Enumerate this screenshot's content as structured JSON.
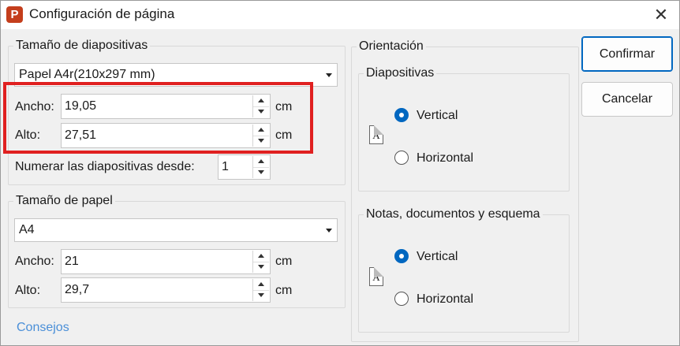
{
  "window": {
    "title": "Configuración de página",
    "app_icon_letter": "P",
    "close_glyph": "✕"
  },
  "slide_size": {
    "legend": "Tamaño de diapositivas",
    "selected": "Papel A4r(210x297 mm)",
    "width_label": "Ancho:",
    "width_value": "19,05",
    "height_label": "Alto:",
    "height_value": "27,51",
    "unit": "cm",
    "number_from_label": "Numerar las diapositivas desde:",
    "number_from_value": "1"
  },
  "paper_size": {
    "legend": "Tamaño de papel",
    "selected": "A4",
    "width_label": "Ancho:",
    "width_value": "21",
    "height_label": "Alto:",
    "height_value": "29,7",
    "unit": "cm"
  },
  "tips_link": "Consejos",
  "orientation": {
    "legend": "Orientación",
    "slides": {
      "legend": "Diapositivas",
      "portrait_label": "Vertical",
      "landscape_label": "Horizontal",
      "selected": "portrait",
      "portrait_icon_text": "A",
      "landscape_icon_text": "A"
    },
    "notes": {
      "legend": "Notas, documentos y esquema",
      "portrait_label": "Vertical",
      "landscape_label": "Horizontal",
      "selected": "portrait",
      "portrait_icon_text": "A",
      "landscape_icon_text": "A"
    }
  },
  "buttons": {
    "confirm": "Confirmar",
    "cancel": "Cancelar"
  },
  "colors": {
    "accent": "#0067c0",
    "highlight": "#e02020",
    "app_icon": "#c43e1c",
    "link": "#4a8fd8"
  }
}
